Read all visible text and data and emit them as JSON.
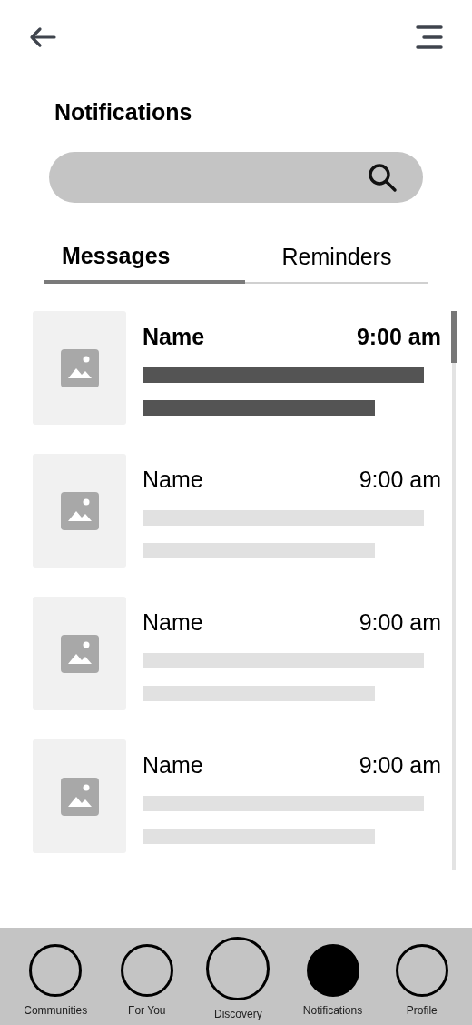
{
  "title": "Notifications",
  "tabs": [
    {
      "label": "Messages",
      "selected": true
    },
    {
      "label": "Reminders",
      "selected": false
    }
  ],
  "messages": [
    {
      "name": "Name",
      "time": "9:00 am",
      "unread": true
    },
    {
      "name": "Name",
      "time": "9:00 am",
      "unread": false
    },
    {
      "name": "Name",
      "time": "9:00 am",
      "unread": false
    },
    {
      "name": "Name",
      "time": "9:00 am",
      "unread": false
    }
  ],
  "nav": [
    {
      "label": "Communities",
      "kind": "regular",
      "selected": false
    },
    {
      "label": "For You",
      "kind": "regular",
      "selected": false
    },
    {
      "label": "Discovery",
      "kind": "large",
      "selected": false
    },
    {
      "label": "Notifications",
      "kind": "regular",
      "selected": true
    },
    {
      "label": "Profile",
      "kind": "regular",
      "selected": false
    }
  ]
}
